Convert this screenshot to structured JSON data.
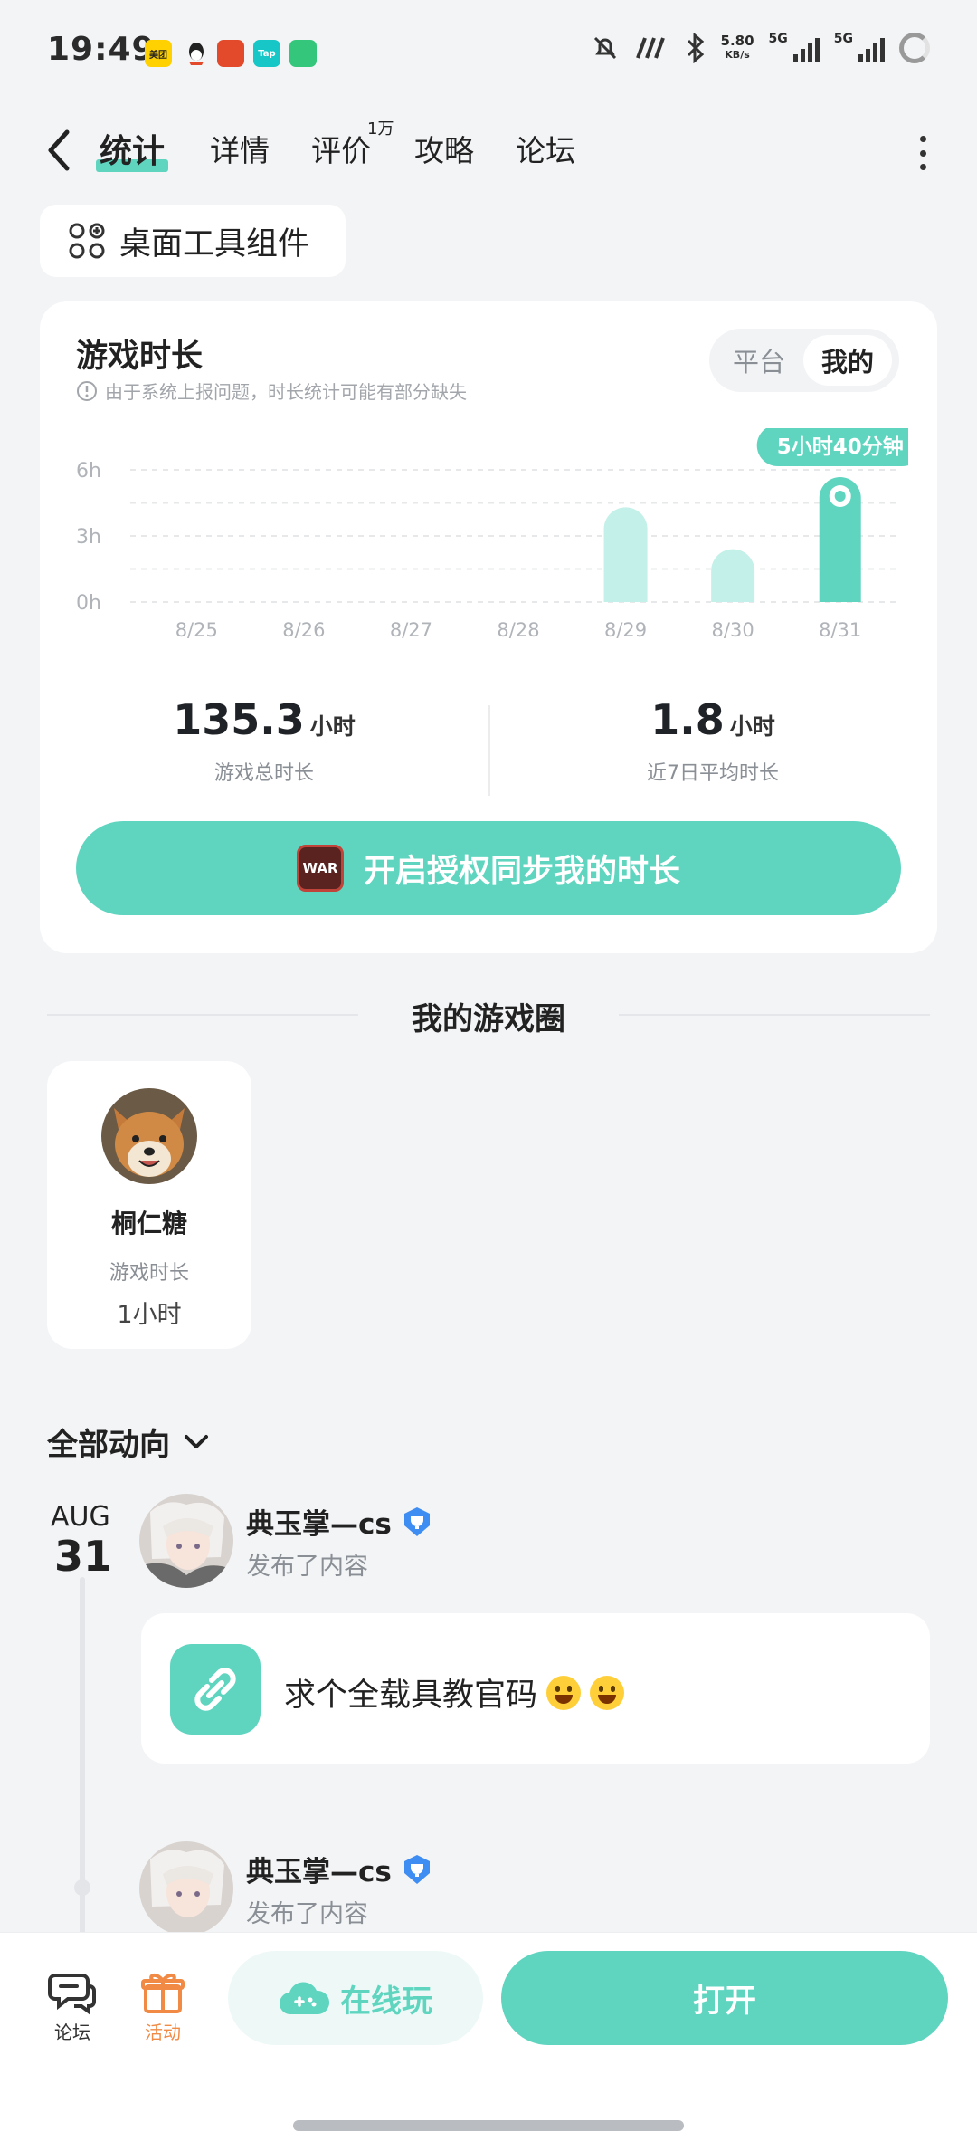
{
  "status_bar": {
    "time": "19:49",
    "app_icons": [
      {
        "name": "meituan-icon",
        "label": "美团",
        "bg": "#ffd100",
        "fg": "#222"
      },
      {
        "name": "qq-icon",
        "label": "",
        "bg": "transparent",
        "fg": "#222"
      },
      {
        "name": "game-app-icon",
        "label": "",
        "bg": "#e24a2b",
        "fg": "#fff"
      },
      {
        "name": "taptap-icon",
        "label": "Tap",
        "bg": "#17c6c6",
        "fg": "#fff"
      },
      {
        "name": "video-app-icon",
        "label": "",
        "bg": "#34c77b",
        "fg": "#fff"
      }
    ],
    "net_speed_value": "5.80",
    "net_speed_unit": "KB/s",
    "signal1_label": "5G",
    "signal2_label": "5G"
  },
  "nav": {
    "tabs": [
      {
        "label": "统计",
        "active": true
      },
      {
        "label": "详情",
        "active": false
      },
      {
        "label": "评价",
        "active": false
      },
      {
        "label": "攻略",
        "active": false
      },
      {
        "label": "论坛",
        "active": false
      }
    ],
    "review_count": "1万"
  },
  "widget_button": {
    "label": "桌面工具组件"
  },
  "stats": {
    "title": "游戏时长",
    "note": "由于系统上报问题，时长统计可能有部分缺失",
    "toggle": {
      "options": [
        "平台",
        "我的"
      ],
      "selected": "我的"
    },
    "total_value": "135.3",
    "total_unit": "小时",
    "total_label": "游戏总时长",
    "avg_value": "1.8",
    "avg_unit": "小时",
    "avg_label": "近7日平均时长",
    "sync_button_label": "开启授权同步我的时长",
    "sync_logo_text": "WAR"
  },
  "chart_data": {
    "type": "bar",
    "categories": [
      "8/25",
      "8/26",
      "8/27",
      "8/28",
      "8/29",
      "8/30",
      "8/31"
    ],
    "values": [
      0,
      0,
      0,
      0,
      4.3,
      2.4,
      5.67
    ],
    "yticks": [
      "0h",
      "3h",
      "6h"
    ],
    "ylim": [
      0,
      6
    ],
    "highlight_index": 6,
    "highlight_label": "5小时40分钟",
    "grid": true,
    "colors": {
      "bar": "#c3f0e8",
      "bar_highlight": "#5fd5c0",
      "label_bg": "#5fd5c0"
    }
  },
  "game_circle": {
    "title": "我的游戏圈",
    "friends": [
      {
        "name": "桐仁糖",
        "label": "游戏时长",
        "hours": "1小时"
      }
    ]
  },
  "feed": {
    "filter_label": "全部动向",
    "date_month": "AUG",
    "date_day": "31",
    "posts": [
      {
        "author": "典玉掌—cs",
        "action": "发布了内容",
        "text": "求个全载具教官码"
      },
      {
        "author": "典玉掌—cs",
        "action": "发布了内容"
      }
    ]
  },
  "bottom_bar": {
    "forum_label": "论坛",
    "activity_label": "活动",
    "play_online_label": "在线玩",
    "open_label": "打开"
  },
  "colors": {
    "accent": "#5fd5c0",
    "accent_light": "#c3f0e8",
    "activity_orange": "#f08a45"
  }
}
